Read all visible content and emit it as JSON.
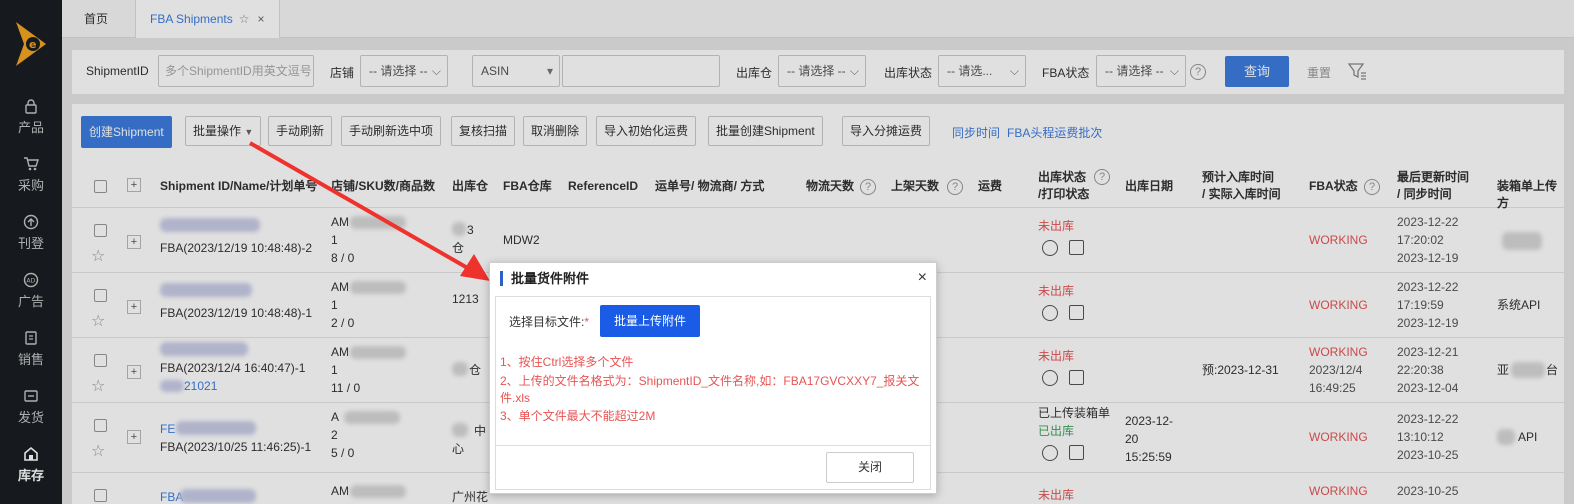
{
  "sidebar": {
    "items": [
      {
        "label": "产品",
        "icon": "lock-icon"
      },
      {
        "label": "采购",
        "icon": "cart-icon"
      },
      {
        "label": "刊登",
        "icon": "upload-icon"
      },
      {
        "label": "广告",
        "icon": "ad-icon"
      },
      {
        "label": "销售",
        "icon": "sales-icon"
      },
      {
        "label": "发货",
        "icon": "truck-icon"
      },
      {
        "label": "库存",
        "icon": "warehouse-icon"
      }
    ],
    "active": "库存"
  },
  "tabs": [
    {
      "label": "首页"
    },
    {
      "label": "FBA Shipments"
    }
  ],
  "filters": {
    "shipment_id_label": "ShipmentID",
    "shipment_id_placeholder": "多个ShipmentID用英文逗号",
    "shop_label": "店铺",
    "shop_value": "-- 请选择 --",
    "asin_value": "ASIN",
    "warehouse_label": "出库仓",
    "warehouse_value": "-- 请选择 --",
    "out_status_label": "出库状态",
    "out_status_value": "-- 请选...",
    "fba_status_label": "FBA状态",
    "fba_status_value": "-- 请选择 --",
    "query_button": "查询",
    "reset_button": "重置"
  },
  "toolbar": {
    "create": "创建Shipment",
    "batch_ops": "批量操作",
    "manual_refresh": "手动刷新",
    "refresh_selected": "手动刷新选中项",
    "recheck_scan": "复核扫描",
    "cancel_delete": "取消删除",
    "import_init_freight": "导入初始化运费",
    "batch_create": "批量创建Shipment",
    "import_split_freight": "导入分摊运费",
    "sync_time": "同步时间",
    "fba_batch": "FBA头程运费批次"
  },
  "table": {
    "headers": {
      "shipment": "Shipment ID/Name/计划单号",
      "shop": "店铺/SKU数/商品数",
      "warehouse": "出库仓",
      "fba_warehouse": "FBA仓库",
      "reference": "ReferenceID",
      "tracking": "运单号/ 物流商/ 方式",
      "logistics_days": "物流天数",
      "shelf_days": "上架天数",
      "freight": "运费",
      "out_status_1": "出库状态",
      "out_status_2": "/打印状态",
      "out_date": "出库日期",
      "eta_1": "预计入库时间",
      "eta_2": "/ 实际入库时间",
      "fba_status": "FBA状态",
      "updated_1": "最后更新时间",
      "updated_2": "/ 同步时间",
      "packing": "装箱单上传方"
    },
    "rows": [
      {
        "name": "FBA(2023/12/19 10:48:48)-2",
        "shop": "AM",
        "sku": "1",
        "qty": "8 / 0",
        "wh": "3",
        "wh2": "仓",
        "fba_wh": "MDW2",
        "status": "未出库",
        "status2": "",
        "out_date": "",
        "eta": "",
        "fba_status": "WORKING",
        "fba_status2": "",
        "fba_status3": "",
        "upd1": "2023-12-22",
        "upd2": "17:20:02",
        "upd3": "2023-12-19",
        "packing": "",
        "plan": ""
      },
      {
        "name": "FBA(2023/12/19 10:48:48)-1",
        "shop": "AM",
        "sku": "1",
        "qty": "2 / 0",
        "wh": "1213",
        "wh2": "",
        "fba_wh": "",
        "status": "未出库",
        "status2": "",
        "out_date": "",
        "eta": "",
        "fba_status": "WORKING",
        "fba_status2": "",
        "fba_status3": "",
        "upd1": "2023-12-22",
        "upd2": "17:19:59",
        "upd3": "2023-12-19",
        "packing": "系统API",
        "plan": ""
      },
      {
        "name": "FBA(2023/12/4 16:40:47)-1",
        "shop": "AM",
        "sku": "1",
        "qty": "11 / 0",
        "wh": "仓",
        "wh2": "",
        "fba_wh": "",
        "status": "未出库",
        "status2": "",
        "out_date": "",
        "eta": "预:2023-12-31",
        "fba_status": "WORKING",
        "fba_status2": "2023/12/4",
        "fba_status3": "16:49:25",
        "upd1": "2023-12-21",
        "upd2": "22:20:38",
        "upd3": "2023-12-04",
        "packing": "亚",
        "packing2": "台",
        "plan": "21021"
      },
      {
        "name": "FBA(2023/10/25 11:46:25)-1",
        "shop": "A",
        "sku": "2",
        "qty": "5 / 0",
        "wh": "中",
        "wh2": "心",
        "fba_wh": "",
        "status": "已上传装箱单",
        "status2": "已出库",
        "out_date": "2023-12-",
        "out_date2": "20",
        "out_date3": "15:25:59",
        "eta": "",
        "fba_status": "WORKING",
        "fba_status2": "",
        "fba_status3": "",
        "upd1": "2023-12-22",
        "upd2": "13:10:12",
        "upd3": "2023-10-25",
        "packing": "API",
        "plan": ""
      },
      {
        "name": "FBA",
        "shop": "AM",
        "wh": "广州花",
        "status": "未出库",
        "fba_status": "WORKING",
        "upd1": "2023-10-25"
      }
    ]
  },
  "modal": {
    "title": "批量货件附件",
    "target_label": "选择目标文件:",
    "required_mark": "*",
    "upload_button": "批量上传附件",
    "hint1": "1、按住Ctrl选择多个文件",
    "hint2a": "2、上传的文件名格式为：ShipmentID_文件名称,如：FBA17GVCXXY7_报关文",
    "hint2b": "件.xls",
    "hint3": "3、单个文件最大不能超过2M",
    "close_button": "关闭"
  },
  "colors": {
    "primary": "#3d7de0",
    "danger": "#e85454",
    "success": "#3ba55c",
    "sidebar": "#1a1d22",
    "arrow": "#f0322d"
  }
}
